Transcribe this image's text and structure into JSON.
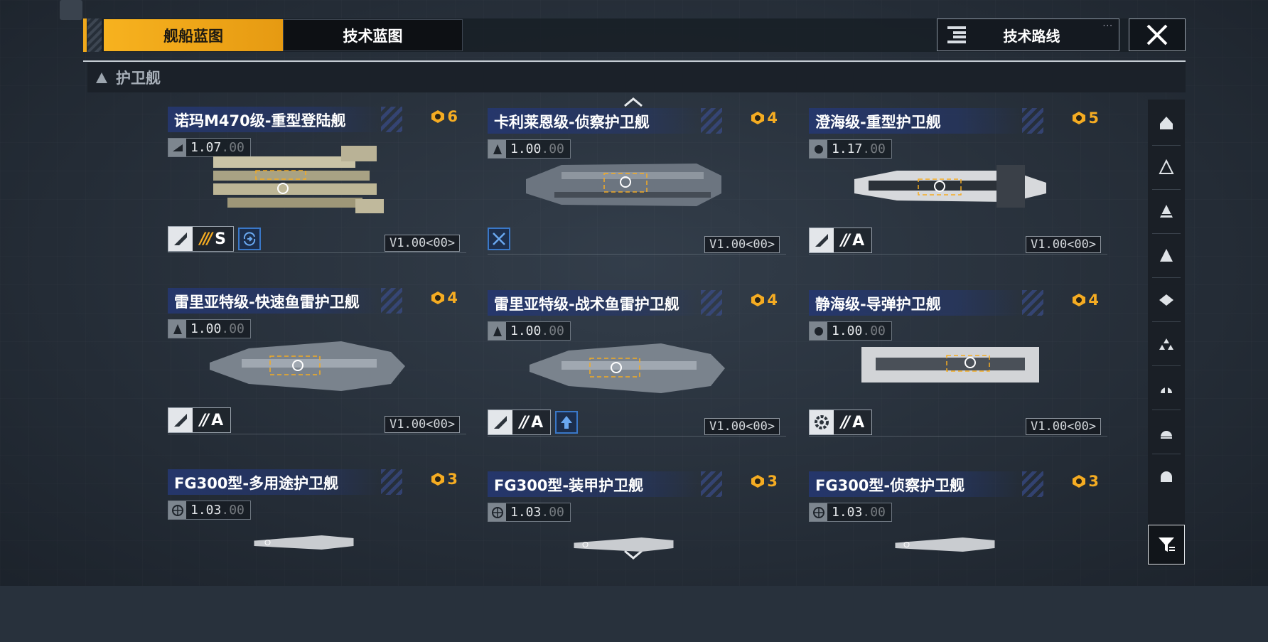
{
  "tabs": {
    "ship_blueprint": "舰船蓝图",
    "tech_blueprint": "技术蓝图"
  },
  "tech_route": {
    "label": "技术路线",
    "dots": "···"
  },
  "category": {
    "label": "护卫舰"
  },
  "cards": [
    {
      "name": "诺玛M470级-重型登陆舰",
      "cost": "6",
      "version": "1.07",
      "version_suffix": ".00",
      "grade": "S",
      "version_tag": "V1.00<00>"
    },
    {
      "name": "卡利莱恩级-侦察护卫舰",
      "cost": "4",
      "version": "1.00",
      "version_suffix": ".00",
      "version_tag": "V1.00<00>"
    },
    {
      "name": "澄海级-重型护卫舰",
      "cost": "5",
      "version": "1.17",
      "version_suffix": ".00",
      "grade": "A",
      "version_tag": "V1.00<00>"
    },
    {
      "name": "雷里亚特级-快速鱼雷护卫舰",
      "cost": "4",
      "version": "1.00",
      "version_suffix": ".00",
      "grade": "A",
      "version_tag": "V1.00<00>"
    },
    {
      "name": "雷里亚特级-战术鱼雷护卫舰",
      "cost": "4",
      "version": "1.00",
      "version_suffix": ".00",
      "grade": "A",
      "version_tag": "V1.00<00>"
    },
    {
      "name": "静海级-导弹护卫舰",
      "cost": "4",
      "version": "1.00",
      "version_suffix": ".00",
      "grade": "A",
      "version_tag": "V1.00<00>"
    },
    {
      "name": "FG300型-多用途护卫舰",
      "cost": "3",
      "version": "1.03",
      "version_suffix": ".00"
    },
    {
      "name": "FG300型-装甲护卫舰",
      "cost": "3",
      "version": "1.03",
      "version_suffix": ".00"
    },
    {
      "name": "FG300型-侦察护卫舰",
      "cost": "3",
      "version": "1.03",
      "version_suffix": ".00"
    }
  ],
  "colors": {
    "accent": "#f5ac22",
    "name_bar": "#25376e",
    "background": "#28313c",
    "skill_blue": "#3a78c8"
  }
}
